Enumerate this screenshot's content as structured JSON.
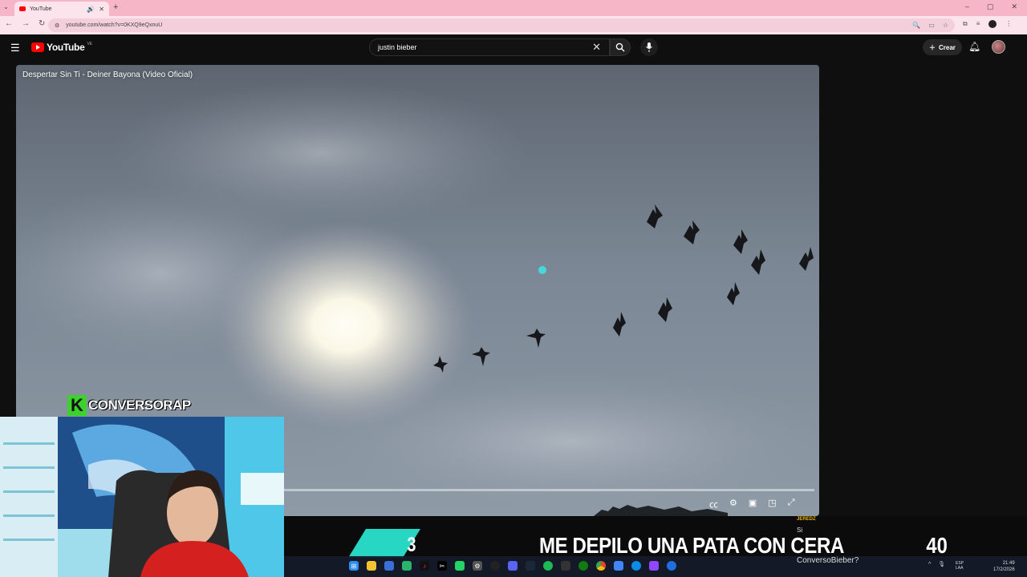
{
  "browser": {
    "tab_title": "YouTube",
    "url": "youtube.com/watch?v=0KXQ9eQxnuU",
    "new_tab_icon": "+",
    "window_controls": [
      "–",
      "▢",
      "✕"
    ]
  },
  "youtube": {
    "logo_text": "YouTube",
    "country_code": "VE",
    "search_query": "justin bieber",
    "create_label": "Crear",
    "video_title": "Despertar Sin Ti - Deiner Bayona (Video Oficial)"
  },
  "overlay": {
    "brand_letter": "K",
    "brand_name": "CONVERSORAP",
    "ticker_number": "3",
    "ticker_text": "ME DEPILO UNA PATA CON CERA",
    "ticker_count": "40",
    "chat_user": "JEREDZ",
    "chat_message": "Si",
    "chat_question": "ConversoBieber?"
  },
  "taskbar": {
    "language": "ESP",
    "language_sub": "LAA",
    "time": "21:49",
    "date": "17/2/2026",
    "apps": [
      "windows-start",
      "file-explorer",
      "shield",
      "notes",
      "tiktok",
      "capcut",
      "whatsapp",
      "settings",
      "obs",
      "discord-blue",
      "steam",
      "spotify",
      "terminal",
      "xbox",
      "chrome",
      "docs",
      "edge",
      "twitch",
      "app"
    ]
  },
  "colors": {
    "tab_bar": "#f7b6c8",
    "yt_red": "#ff0000",
    "brand_green": "#3dd12b",
    "ticker_teal": "#28d6c4",
    "chat_user": "#f4b400"
  }
}
